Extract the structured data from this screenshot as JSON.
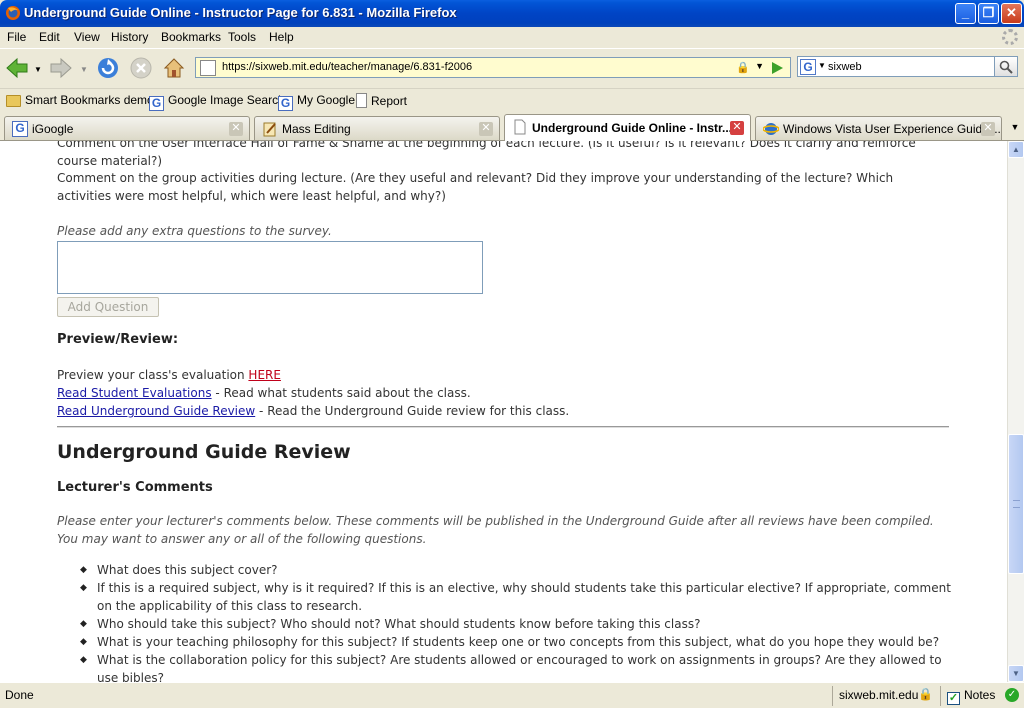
{
  "window": {
    "title": "Underground Guide Online - Instructor Page for 6.831 - Mozilla Firefox"
  },
  "menu": [
    "File",
    "Edit",
    "View",
    "History",
    "Bookmarks",
    "Tools",
    "Help"
  ],
  "navbar": {
    "url": "https://sixweb.mit.edu/teacher/manage/6.831-f2006",
    "search_value": "sixweb"
  },
  "bookmarks": [
    "Smart Bookmarks demos",
    "Google Image Search",
    "My Google",
    "Report"
  ],
  "tabs": [
    {
      "label": "iGoogle"
    },
    {
      "label": "Mass Editing"
    },
    {
      "label": "Underground Guide Online - Instr..."
    },
    {
      "label": "Windows Vista User Experience Guideli..."
    }
  ],
  "content": {
    "q_cut": "Comment on the User Interface Hall of Fame & Shame at the beginning of each lecture. (Is it useful? Is it relevant? Does it clarify and reinforce course material?)",
    "q_group": "Comment on the group activities during lecture. (Are they useful and relevant? Did they improve your understanding of the lecture? Which activities were most helpful, which were least helpful, and why?)",
    "extra_prompt": "Please add any extra questions to the survey.",
    "add_question_button": "Add Question",
    "preview_heading": "Preview/Review:",
    "preview_text": "Preview your class's evaluation",
    "preview_link": "HERE",
    "read_student_link": "Read Student Evaluations",
    "read_student_text": "- Read what students said about the class.",
    "read_guide_link": "Read Underground Guide Review",
    "read_guide_text": "- Read the Underground Guide review for this class.",
    "ug_review_heading": "Underground Guide Review",
    "lecturer_heading": "Lecturer's Comments",
    "lecturer_instructions": "Please enter your lecturer's comments below. These comments will be published in the Underground Guide after all reviews have been compiled. You may want to answer any or all of the following questions.",
    "questions": [
      "What does this subject cover?",
      "If this is a required subject, why is it required? If this is an elective, why should students take this particular elective? If appropriate, comment on the applicability of this class to research.",
      "Who should take this subject? Who should not? What should students know before taking this class?",
      "What is your teaching philosophy for this subject? If students keep one or two concepts from this subject, what do you hope they would be?",
      "What is the collaboration policy for this subject? Are students allowed or encouraged to work on assignments in groups? Are they allowed to use bibles?"
    ]
  },
  "status": {
    "text": "Done",
    "host": "sixweb.mit.edu",
    "notes": "Notes"
  }
}
